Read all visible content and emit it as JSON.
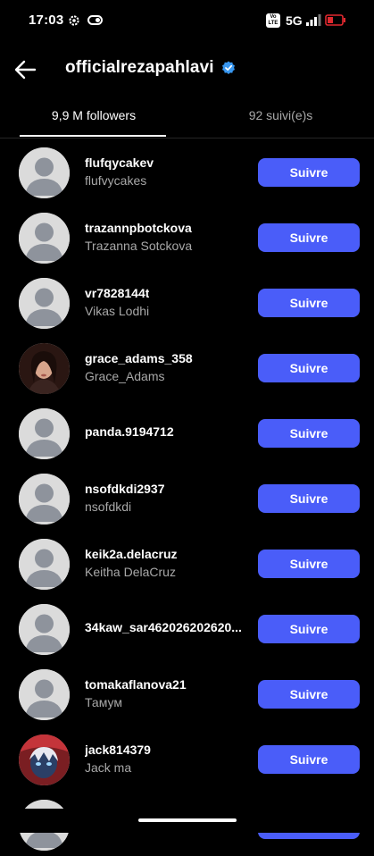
{
  "status_bar": {
    "time": "17:03",
    "volte_line1": "Vo",
    "volte_line2": "LTE",
    "network": "5G"
  },
  "header": {
    "title": "officialrezapahlavi",
    "verified": true
  },
  "tabs": [
    {
      "label": "9,9 M followers",
      "active": true
    },
    {
      "label": "92 suivi(e)s",
      "active": false
    }
  ],
  "follow_button_label": "Suivre",
  "followers": [
    {
      "username": "flufqycakev",
      "full_name": "flufvycakes",
      "avatar": "default"
    },
    {
      "username": "trazannpbotckova",
      "full_name": "Trazanna Sotckova",
      "avatar": "default"
    },
    {
      "username": "vr7828144t",
      "full_name": "Vikas Lodhi",
      "avatar": "default"
    },
    {
      "username": "grace_adams_358",
      "full_name": "Grace_Adams",
      "avatar": "photo-portrait"
    },
    {
      "username": "panda.9194712",
      "full_name": "",
      "avatar": "default"
    },
    {
      "username": "nsofdkdi2937",
      "full_name": "nsofdkdi",
      "avatar": "default"
    },
    {
      "username": "keik2a.delacruz",
      "full_name": "Keitha DelaCruz",
      "avatar": "default"
    },
    {
      "username": "34kaw_sar462026202620...",
      "full_name": "",
      "avatar": "default"
    },
    {
      "username": "tomakaflanova21",
      "full_name": "Тамум",
      "avatar": "default"
    },
    {
      "username": "jack814379",
      "full_name": "Jack ma",
      "avatar": "anime-art"
    }
  ],
  "colors": {
    "background": "#000000",
    "button": "#4a5df9",
    "secondary_text": "#a8a8a8",
    "verified": "#3897f0",
    "battery_low": "#e0292f"
  }
}
